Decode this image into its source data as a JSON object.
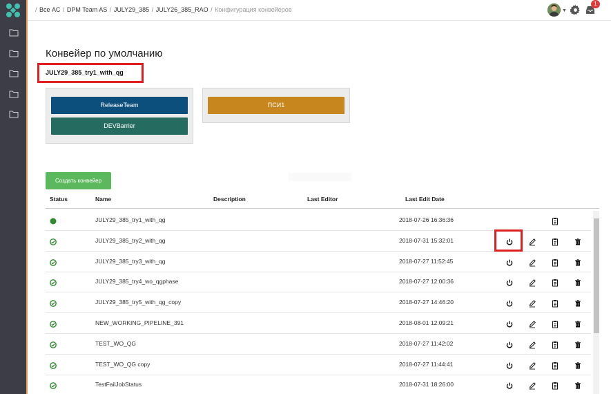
{
  "breadcrumb": {
    "items": [
      "Все АС",
      "DPM Team AS",
      "JULY29_385",
      "JULY26_385_RAO"
    ],
    "current": "Конфигурация конвейеров",
    "separator": "/"
  },
  "header": {
    "notification_count": "1",
    "icons": [
      "user-avatar",
      "gear-icon",
      "inbox-icon"
    ]
  },
  "sidebar": {
    "logo": "app-logo",
    "items": [
      "folder-icon",
      "folder-icon",
      "folder-icon",
      "folder-icon",
      "folder-icon"
    ]
  },
  "page": {
    "title": "Конвейер по умолчанию",
    "default_pipeline": "JULY29_385_try1_with_qg"
  },
  "stages": {
    "group1": [
      "ReleaseTeam",
      "DEVBarrier"
    ],
    "group2": [
      "ПСИ1"
    ]
  },
  "create_button": "Создать конвейер",
  "table": {
    "headers": {
      "status": "Status",
      "name": "Name",
      "description": "Description",
      "editor": "Last Editor",
      "date": "Last Edit Date"
    },
    "rows": [
      {
        "status": "active",
        "name": "JULY29_385_try1_with_qg",
        "date": "2018-07-26 16:36:36",
        "actions": [
          "clipboard"
        ]
      },
      {
        "status": "ok",
        "name": "JULY29_385_try2_with_qg",
        "date": "2018-07-31 15:32:01",
        "actions": [
          "power",
          "edit",
          "clipboard",
          "delete"
        ]
      },
      {
        "status": "ok",
        "name": "JULY29_385_try3_with_qg",
        "date": "2018-07-27 11:52:45",
        "actions": [
          "power",
          "edit",
          "clipboard",
          "delete"
        ]
      },
      {
        "status": "ok",
        "name": "JULY29_385_try4_wo_qgphase",
        "date": "2018-07-27 12:00:36",
        "actions": [
          "power",
          "edit",
          "clipboard",
          "delete"
        ]
      },
      {
        "status": "ok",
        "name": "JULY29_385_try5_with_qg_copy",
        "date": "2018-07-27 14:46:20",
        "actions": [
          "power",
          "edit",
          "clipboard",
          "delete"
        ]
      },
      {
        "status": "ok",
        "name": "NEW_WORKING_PIPELINE_391",
        "date": "2018-08-01 12:09:21",
        "actions": [
          "power",
          "edit",
          "clipboard",
          "delete"
        ]
      },
      {
        "status": "ok",
        "name": "TEST_WO_QG",
        "date": "2018-07-27 11:42:02",
        "actions": [
          "power",
          "edit",
          "clipboard",
          "delete"
        ]
      },
      {
        "status": "ok",
        "name": "TEST_WO_QG copy",
        "date": "2018-07-27 11:44:41",
        "actions": [
          "power",
          "edit",
          "clipboard",
          "delete"
        ]
      },
      {
        "status": "ok",
        "name": "TestFailJobStatus",
        "date": "2018-07-31 18:26:00",
        "actions": [
          "power",
          "edit",
          "clipboard",
          "delete"
        ]
      }
    ]
  },
  "colors": {
    "sidebar": "#3d3d47",
    "sidebar_accent": "#e8a44a",
    "stage_blue": "#0d4f7c",
    "stage_teal": "#256b60",
    "stage_orange": "#c8861f",
    "create_green": "#5cb85c",
    "status_green": "#2e8b2e",
    "highlight_red": "#e02020"
  }
}
